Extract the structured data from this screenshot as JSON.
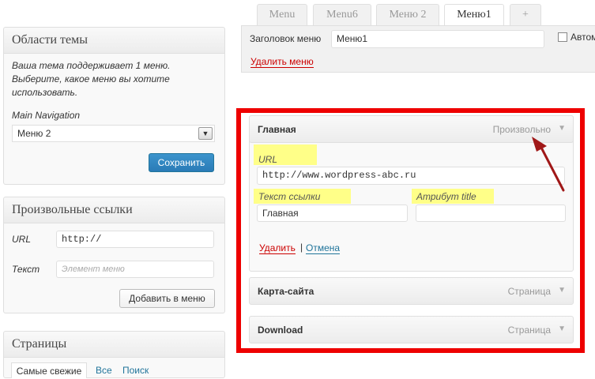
{
  "theme_locations": {
    "title": "Области темы",
    "description": "Ваша тема поддерживает 1 меню. Выберите, какое меню вы хотите использовать.",
    "location_label": "Main Navigation",
    "selected_menu": "Меню 2",
    "save_label": "Сохранить"
  },
  "custom_links": {
    "title": "Произвольные ссылки",
    "url_label": "URL",
    "url_value": "http://",
    "text_label": "Текст",
    "text_placeholder": "Элемент меню",
    "add_label": "Добавить в меню"
  },
  "pages": {
    "title": "Страницы",
    "tabs": [
      "Самые свежие",
      "Все",
      "Поиск"
    ]
  },
  "tabs": [
    "Menu",
    "Menu6",
    "Меню 2",
    "Меню1",
    "+"
  ],
  "menu_header": {
    "name_label": "Заголовок меню",
    "name_value": "Меню1",
    "auto_label": "Автом",
    "delete_label": "Удалить меню"
  },
  "items": [
    {
      "title": "Главная",
      "type": "Произвольно",
      "url_label": "URL",
      "url_value": "http://www.wordpress-abc.ru",
      "link_text_label": "Текст ссылки",
      "link_text_value": "Главная",
      "title_attr_label": "Атрибут title",
      "title_attr_value": "",
      "remove_label": "Удалить",
      "separator": "|",
      "cancel_label": "Отмена"
    },
    {
      "title": "Карта-сайта",
      "type": "Страница"
    },
    {
      "title": "Download",
      "type": "Страница"
    }
  ],
  "colors": {
    "annotation_red": "#ee0000",
    "highlight_yellow": "#ffff88",
    "arrow": "#a01818",
    "primary_button": "#2a7bb7"
  }
}
